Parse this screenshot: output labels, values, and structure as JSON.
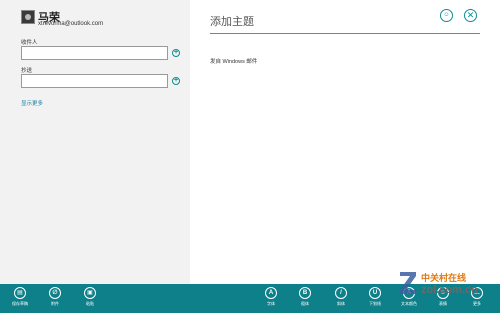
{
  "sender": {
    "name": "马荣",
    "email": "xtrevorma@outlook.com"
  },
  "fields": {
    "to_label": "收件人",
    "to_value": "",
    "cc_label": "抄送",
    "cc_value": "",
    "add_symbol": "+",
    "show_more": "显示更多"
  },
  "message": {
    "subject_placeholder": "添加主题",
    "signature": "发自 Windows 邮件"
  },
  "top_icons": {
    "emoji_glyph": "☺",
    "close_glyph": "✕"
  },
  "appbar": {
    "left": [
      {
        "label": "保存草稿",
        "icon": "save-draft-icon",
        "glyph": "▤"
      },
      {
        "label": "附件",
        "icon": "attachment-icon",
        "glyph": "∅"
      },
      {
        "label": "粘贴",
        "icon": "paste-icon",
        "glyph": "▣"
      }
    ],
    "right": [
      {
        "label": "字体",
        "icon": "font-icon",
        "glyph": "A"
      },
      {
        "label": "粗体",
        "icon": "bold-icon",
        "glyph": "B"
      },
      {
        "label": "斜体",
        "icon": "italic-icon",
        "glyph": "/"
      },
      {
        "label": "下划线",
        "icon": "underline-icon",
        "glyph": "U"
      },
      {
        "label": "文本颜色",
        "icon": "text-color-icon",
        "glyph": "A"
      },
      {
        "label": "表情",
        "icon": "emoji-icon",
        "glyph": "☺"
      },
      {
        "label": "更多",
        "icon": "more-icon",
        "glyph": "…"
      }
    ]
  },
  "watermark": {
    "cn": "中关村在线",
    "url": "zol.com.cn"
  },
  "colors": {
    "accent": "#0e8089",
    "link": "#1a7fa0",
    "watermark_orange": "#e07a10"
  }
}
